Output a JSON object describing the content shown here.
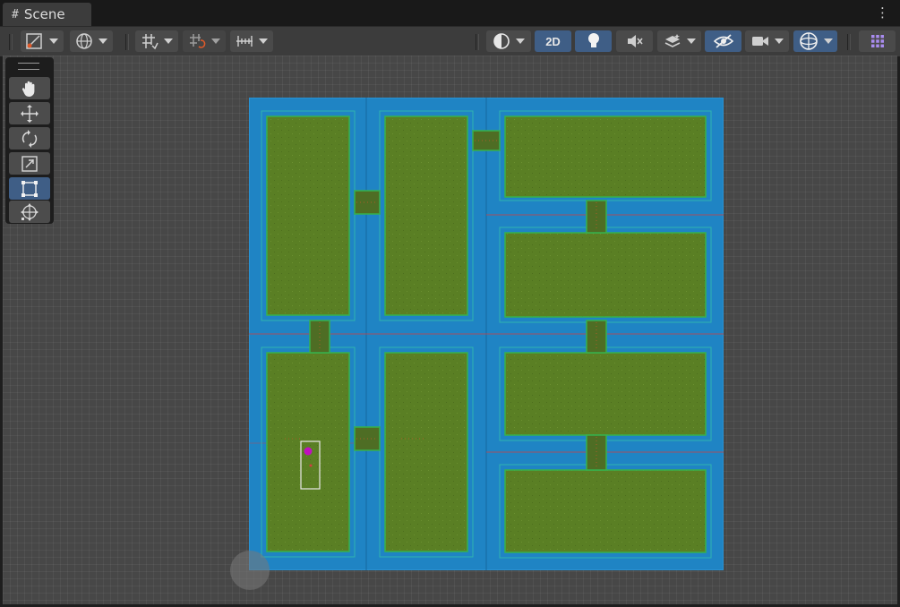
{
  "window": {
    "tab_icon": "#",
    "tab_title": "Scene",
    "menu_icon": "⋮"
  },
  "toolbar": {
    "left_groups": [
      {
        "icon": "draw-mode-icon",
        "has_dropdown": true
      },
      {
        "icon": "globe-icon",
        "has_dropdown": true
      },
      {
        "icon": "grid-snap-icon",
        "has_dropdown": true
      },
      {
        "icon": "increment-snap-icon",
        "has_dropdown": true
      },
      {
        "icon": "ruler-icon",
        "has_dropdown": true
      }
    ],
    "right": {
      "shading_icon": "shading-mode-icon",
      "two_d_label": "2D",
      "lighting_icon": "lightbulb-icon",
      "audio_icon": "audio-mute-icon",
      "effects_icon": "effects-layers-icon",
      "visibility_icon": "hidden-eye-icon",
      "camera_icon": "camera-icon",
      "gizmos_icon": "gizmos-icon",
      "grid_icon": "overlay-grid-icon"
    }
  },
  "tools": [
    {
      "name": "hand-tool",
      "icon": "hand-icon",
      "active": false
    },
    {
      "name": "move-tool",
      "icon": "move-arrows-icon",
      "active": false
    },
    {
      "name": "rotate-tool",
      "icon": "rotate-icon",
      "active": false
    },
    {
      "name": "scale-tool",
      "icon": "scale-icon",
      "active": false
    },
    {
      "name": "rect-tool",
      "icon": "rect-transform-icon",
      "active": true
    },
    {
      "name": "transform-tool",
      "icon": "transform-icon",
      "active": false
    }
  ],
  "colors": {
    "water": "#1f84c4",
    "grass": "#5a7f24",
    "grass_outline": "#37b14c",
    "bridge": "#4e6d24",
    "accent_blue": "#3f5e86",
    "player": "#c010c0",
    "axis_red": "#d04040"
  }
}
